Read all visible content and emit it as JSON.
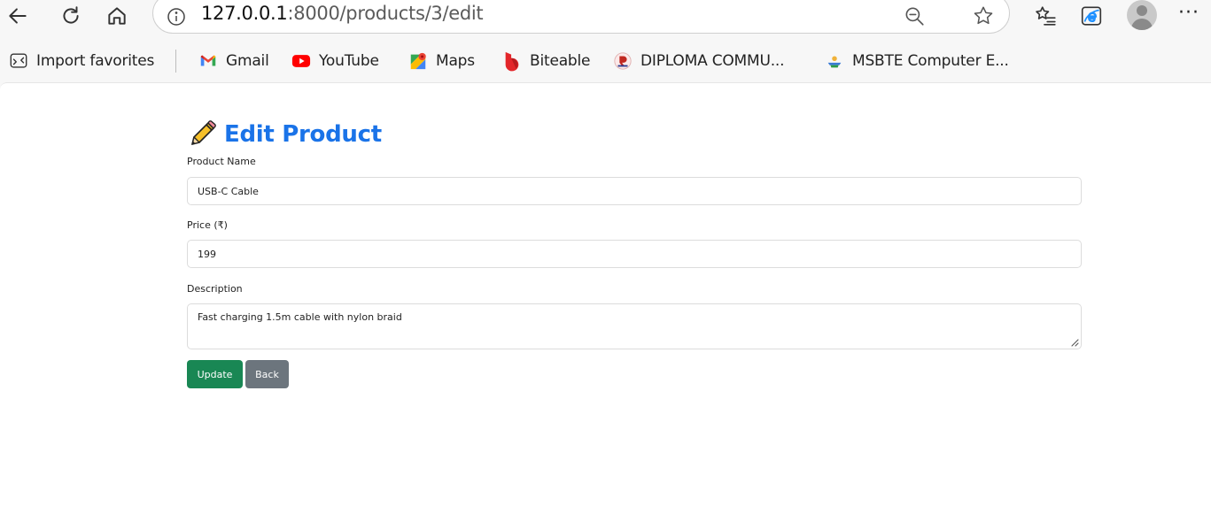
{
  "browser": {
    "url_host": "127.0.0.1",
    "url_rest": ":8000/products/3/edit"
  },
  "favorites": [
    {
      "label": "Import favorites",
      "icon": "import-favorites-icon"
    },
    {
      "label": "Gmail",
      "icon": "gmail-icon"
    },
    {
      "label": "YouTube",
      "icon": "youtube-icon"
    },
    {
      "label": "Maps",
      "icon": "maps-icon"
    },
    {
      "label": "Biteable",
      "icon": "biteable-icon"
    },
    {
      "label": "DIPLOMA COMMU...",
      "icon": "diploma-icon"
    },
    {
      "label": "MSBTE Computer E...",
      "icon": "msbte-icon"
    }
  ],
  "form": {
    "title": "Edit Product",
    "name_label": "Product Name",
    "name_value": "USB-C Cable",
    "price_label": "Price (₹)",
    "price_value": "199",
    "description_label": "Description",
    "description_value": "Fast charging 1.5m cable with nylon braid",
    "update_label": "Update",
    "back_label": "Back"
  },
  "colors": {
    "title": "#1a73e8",
    "update_button": "#198754",
    "back_button": "#6c757d"
  }
}
